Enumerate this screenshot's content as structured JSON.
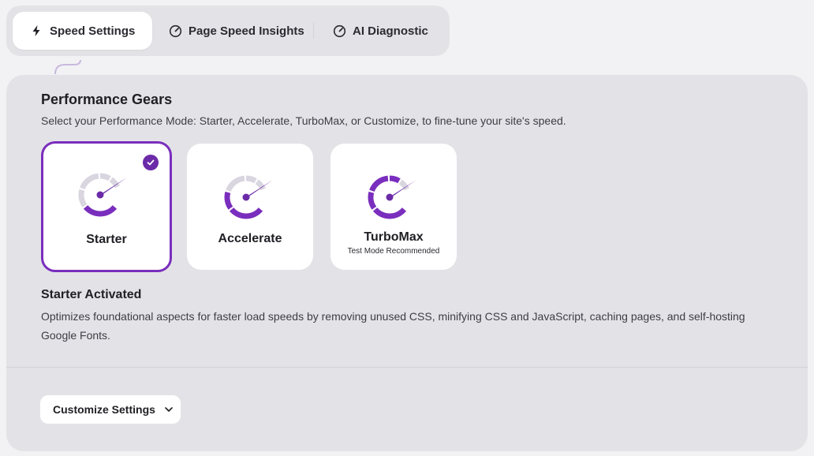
{
  "tabs": [
    {
      "label": "Speed Settings",
      "icon": "bolt-icon",
      "active": true
    },
    {
      "label": "Page Speed Insights",
      "icon": "gauge-icon",
      "active": false
    },
    {
      "label": "AI Diagnostic",
      "icon": "gauge-icon",
      "active": false
    }
  ],
  "section": {
    "title": "Performance Gears",
    "subtitle": "Select your Performance Mode: Starter, Accelerate, TurboMax, or Customize, to fine-tune your site's speed."
  },
  "cards": [
    {
      "label": "Starter",
      "selected": true,
      "level": 1
    },
    {
      "label": "Accelerate",
      "selected": false,
      "level": 2
    },
    {
      "label": "TurboMax",
      "sublabel": "Test Mode Recommended",
      "selected": false,
      "level": 3
    }
  ],
  "activated": {
    "title": "Starter Activated",
    "description": "Optimizes foundational aspects for faster load speeds by removing unused CSS, minifying CSS and JavaScript, caching pages, and self-hosting Google Fonts."
  },
  "customize_button": {
    "label": "Customize Settings",
    "icon": "chevron-down-icon"
  },
  "colors": {
    "accent": "#7a2ebd",
    "accent_dark": "#6b2aa8",
    "gauge_inactive": "#d9d6e0",
    "panel_bg": "#e3e3e7"
  }
}
